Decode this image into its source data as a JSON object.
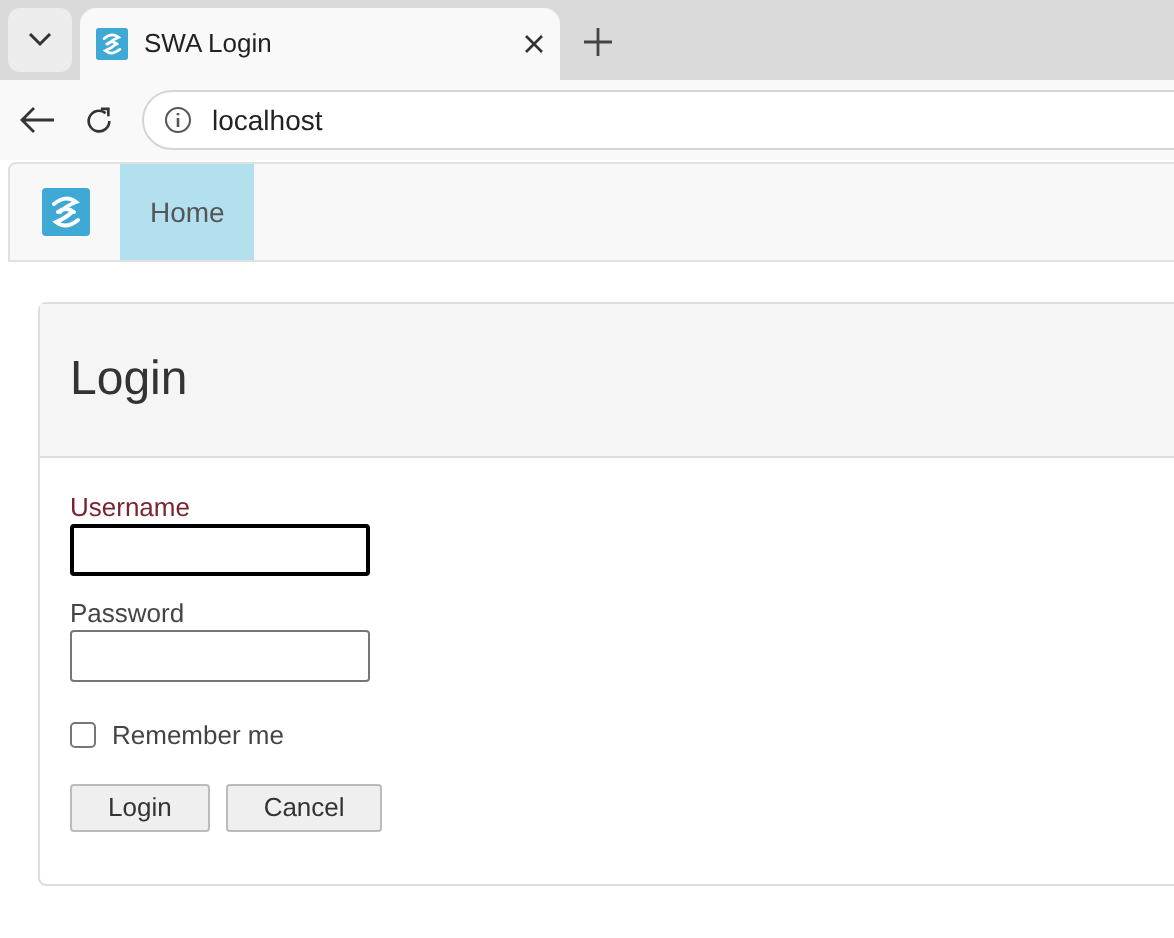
{
  "browser": {
    "tab_title": "SWA Login",
    "address": "localhost"
  },
  "navbar": {
    "items": [
      {
        "label": "Home",
        "selected": true
      }
    ]
  },
  "panel": {
    "title": "Login",
    "fields": [
      {
        "label": "Username",
        "focused": true
      },
      {
        "label": "Password",
        "focused": false
      }
    ],
    "remember": {
      "label": "Remember me",
      "checked": false
    },
    "buttons": [
      "Login",
      "Cancel"
    ]
  }
}
